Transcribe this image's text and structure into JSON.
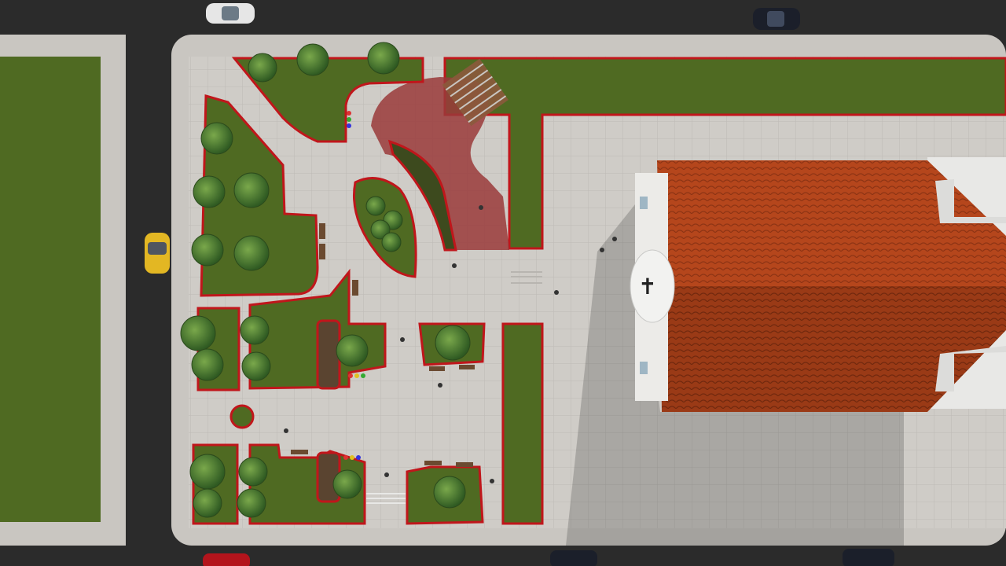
{
  "scene": {
    "description_label": "",
    "palette": {
      "asphalt": "#2b2b2b",
      "sidewalk": "#c9c6c1",
      "plaza": "#cfccc7",
      "lawn": "#4f6a22",
      "lawn_dark": "#3f561b",
      "curb_red": "#c0161b",
      "roof": "#b5461c",
      "roof_dark": "#8e3414",
      "wall": "#e8e8e6",
      "shadow": "rgba(0,0,0,0.28)",
      "tree": "#3f6d2a",
      "tree_light": "#6a9a3f",
      "car_white": "#e6e6e6",
      "car_yellow": "#e3b723",
      "car_dark": "#1b1f2a",
      "car_red": "#b3141c"
    },
    "church": {
      "symbol": "✝",
      "symbol_label": "cross-icon"
    },
    "cars": [
      {
        "name": "white-car",
        "color": "#e6e6e6"
      },
      {
        "name": "dark-car",
        "color": "#1b1f2a"
      },
      {
        "name": "yellow-car",
        "color": "#e3b723"
      },
      {
        "name": "red-car",
        "color": "#b3141c"
      },
      {
        "name": "dark-car-bottom-1",
        "color": "#1b1f2a"
      },
      {
        "name": "dark-car-bottom-2",
        "color": "#1b1f2a"
      }
    ]
  }
}
